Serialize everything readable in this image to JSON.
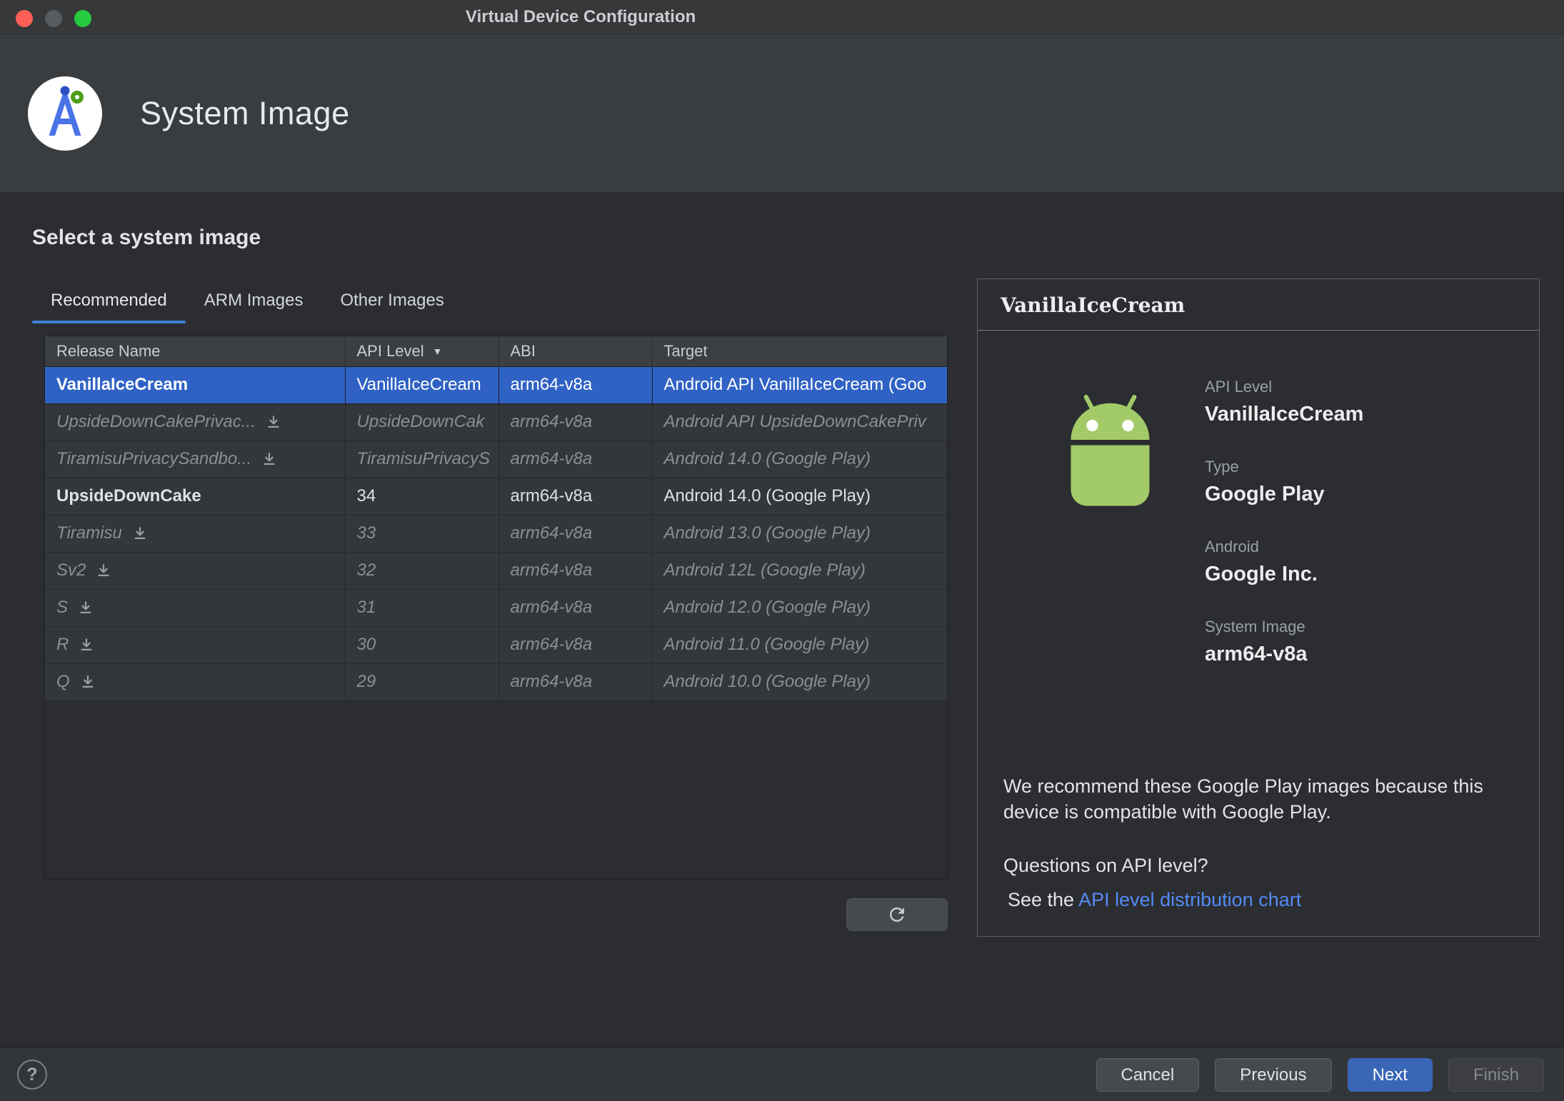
{
  "window": {
    "title": "Virtual Device Configuration"
  },
  "header": {
    "title": "System Image"
  },
  "content": {
    "heading": "Select a system image",
    "tabs": [
      {
        "label": "Recommended",
        "active": true
      },
      {
        "label": "ARM Images",
        "active": false
      },
      {
        "label": "Other Images",
        "active": false
      }
    ],
    "table": {
      "columns": [
        "Release Name",
        "API Level",
        "ABI",
        "Target"
      ],
      "sort_icon": "▼",
      "sorted_by": "API Level",
      "rows": [
        {
          "release": "VanillaIceCream",
          "api": "VanillaIceCream",
          "abi": "arm64-v8a",
          "target": "Android API VanillaIceCream (Goo",
          "selected": true,
          "installed": true,
          "download": false,
          "dimmed": false
        },
        {
          "release": "UpsideDownCakePrivac...",
          "api": "UpsideDownCak",
          "abi": "arm64-v8a",
          "target": "Android API UpsideDownCakePriv",
          "selected": false,
          "installed": false,
          "download": true,
          "dimmed": true
        },
        {
          "release": "TiramisuPrivacySandbo...",
          "api": "TiramisuPrivacyS",
          "abi": "arm64-v8a",
          "target": "Android 14.0 (Google Play)",
          "selected": false,
          "installed": false,
          "download": true,
          "dimmed": true
        },
        {
          "release": "UpsideDownCake",
          "api": "34",
          "abi": "arm64-v8a",
          "target": "Android 14.0 (Google Play)",
          "selected": false,
          "installed": true,
          "download": false,
          "dimmed": false
        },
        {
          "release": "Tiramisu",
          "api": "33",
          "abi": "arm64-v8a",
          "target": "Android 13.0 (Google Play)",
          "selected": false,
          "installed": false,
          "download": true,
          "dimmed": true
        },
        {
          "release": "Sv2",
          "api": "32",
          "abi": "arm64-v8a",
          "target": "Android 12L (Google Play)",
          "selected": false,
          "installed": false,
          "download": true,
          "dimmed": true
        },
        {
          "release": "S",
          "api": "31",
          "abi": "arm64-v8a",
          "target": "Android 12.0 (Google Play)",
          "selected": false,
          "installed": false,
          "download": true,
          "dimmed": true
        },
        {
          "release": "R",
          "api": "30",
          "abi": "arm64-v8a",
          "target": "Android 11.0 (Google Play)",
          "selected": false,
          "installed": false,
          "download": true,
          "dimmed": true
        },
        {
          "release": "Q",
          "api": "29",
          "abi": "arm64-v8a",
          "target": "Android 10.0 (Google Play)",
          "selected": false,
          "installed": false,
          "download": true,
          "dimmed": true
        }
      ]
    }
  },
  "details": {
    "title": "VanillaIceCream",
    "fields": [
      {
        "label": "API Level",
        "value": "VanillaIceCream"
      },
      {
        "label": "Type",
        "value": "Google Play"
      },
      {
        "label": "Android",
        "value": "Google Inc."
      },
      {
        "label": "System Image",
        "value": "arm64-v8a"
      }
    ],
    "recommendation": "We recommend these Google Play images because this device is compatible with Google Play.",
    "question": "Questions on API level?",
    "see_prefix": "See the ",
    "link_text": "API level distribution chart"
  },
  "footer": {
    "help_label": "?",
    "buttons": [
      {
        "label": "Cancel",
        "style": "secondary",
        "enabled": true
      },
      {
        "label": "Previous",
        "style": "secondary",
        "enabled": true
      },
      {
        "label": "Next",
        "style": "primary",
        "enabled": true
      },
      {
        "label": "Finish",
        "style": "disabled",
        "enabled": false
      }
    ]
  },
  "icons": {
    "download": "download-to-tray",
    "refresh": "refresh-circular-arrow",
    "sort": "descending-triangle",
    "help": "question-mark",
    "logo": "android-studio-compass",
    "robot": "android-robot"
  },
  "colors": {
    "selection_blue": "#2f62c4",
    "primary_button_blue": "#3a66b8",
    "tab_underline_blue": "#3f80d8",
    "link_blue": "#548af7",
    "robot_green": "#a3ca68",
    "traffic_red": "#fe5f57",
    "traffic_gray": "#575b5d",
    "traffic_green": "#27c93f"
  }
}
